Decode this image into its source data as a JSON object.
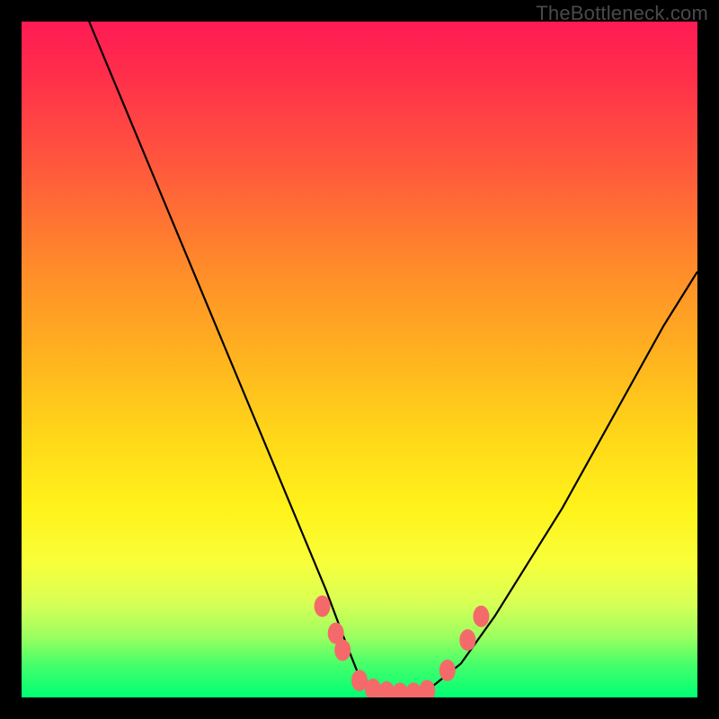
{
  "watermark": "TheBottleneck.com",
  "chart_data": {
    "type": "line",
    "title": "",
    "xlabel": "",
    "ylabel": "",
    "xlim": [
      0,
      100
    ],
    "ylim": [
      0,
      100
    ],
    "series": [
      {
        "name": "bottleneck-curve",
        "x": [
          10,
          15,
          20,
          25,
          30,
          35,
          40,
          45,
          48,
          50,
          52,
          55,
          58,
          60,
          65,
          70,
          75,
          80,
          85,
          90,
          95,
          100
        ],
        "y": [
          100,
          88,
          76,
          64,
          52,
          40,
          28,
          16,
          8,
          3,
          1,
          0,
          0,
          1,
          5,
          12,
          20,
          28,
          37,
          46,
          55,
          63
        ]
      }
    ],
    "markers": [
      {
        "x": 44.5,
        "y": 13.5
      },
      {
        "x": 46.5,
        "y": 9.5
      },
      {
        "x": 47.5,
        "y": 7.0
      },
      {
        "x": 50.0,
        "y": 2.5
      },
      {
        "x": 52.0,
        "y": 1.2
      },
      {
        "x": 54.0,
        "y": 0.8
      },
      {
        "x": 56.0,
        "y": 0.6
      },
      {
        "x": 58.0,
        "y": 0.6
      },
      {
        "x": 60.0,
        "y": 1.0
      },
      {
        "x": 63.0,
        "y": 4.0
      },
      {
        "x": 66.0,
        "y": 8.5
      },
      {
        "x": 68.0,
        "y": 12.0
      }
    ],
    "marker_color": "#f46a6a",
    "line_color": "#000000"
  }
}
